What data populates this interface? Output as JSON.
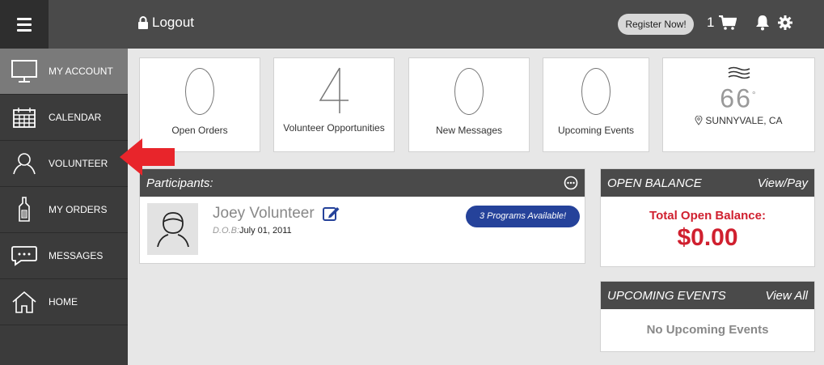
{
  "topbar": {
    "logout_label": "Logout",
    "register_label": "Register Now!",
    "cart_count": "1"
  },
  "sidebar": {
    "items": [
      {
        "label": "MY ACCOUNT",
        "icon": "monitor-icon"
      },
      {
        "label": "CALENDAR",
        "icon": "calendar-icon"
      },
      {
        "label": "VOLUNTEER",
        "icon": "person-icon"
      },
      {
        "label": "MY ORDERS",
        "icon": "bottle-icon"
      },
      {
        "label": "MESSAGES",
        "icon": "message-icon"
      },
      {
        "label": "HOME",
        "icon": "home-icon"
      }
    ]
  },
  "tiles": [
    {
      "value": "0",
      "label": "Open Orders"
    },
    {
      "value": "4",
      "label": "Volunteer Opportunities"
    },
    {
      "value": "0",
      "label": "New Messages"
    },
    {
      "value": "0",
      "label": "Upcoming Events"
    }
  ],
  "weather": {
    "temperature": "66",
    "degree": "°",
    "location": "SUNNYVALE, CA"
  },
  "participants": {
    "title": "Participants:",
    "name": "Joey Volunteer",
    "dob_label": "D.O.B:",
    "dob_value": "July 01, 2011",
    "programs_label": "3 Programs Available!"
  },
  "balance": {
    "title": "OPEN BALANCE",
    "link": "View/Pay",
    "label": "Total Open Balance:",
    "amount": "$0.00"
  },
  "events": {
    "title": "UPCOMING EVENTS",
    "link": "View All",
    "empty_text": "No Upcoming Events"
  },
  "colors": {
    "topbar": "#4a4a4a",
    "sidebar": "#3b3b3b",
    "accent_red": "#d0202f",
    "programs_blue": "#25429a"
  }
}
